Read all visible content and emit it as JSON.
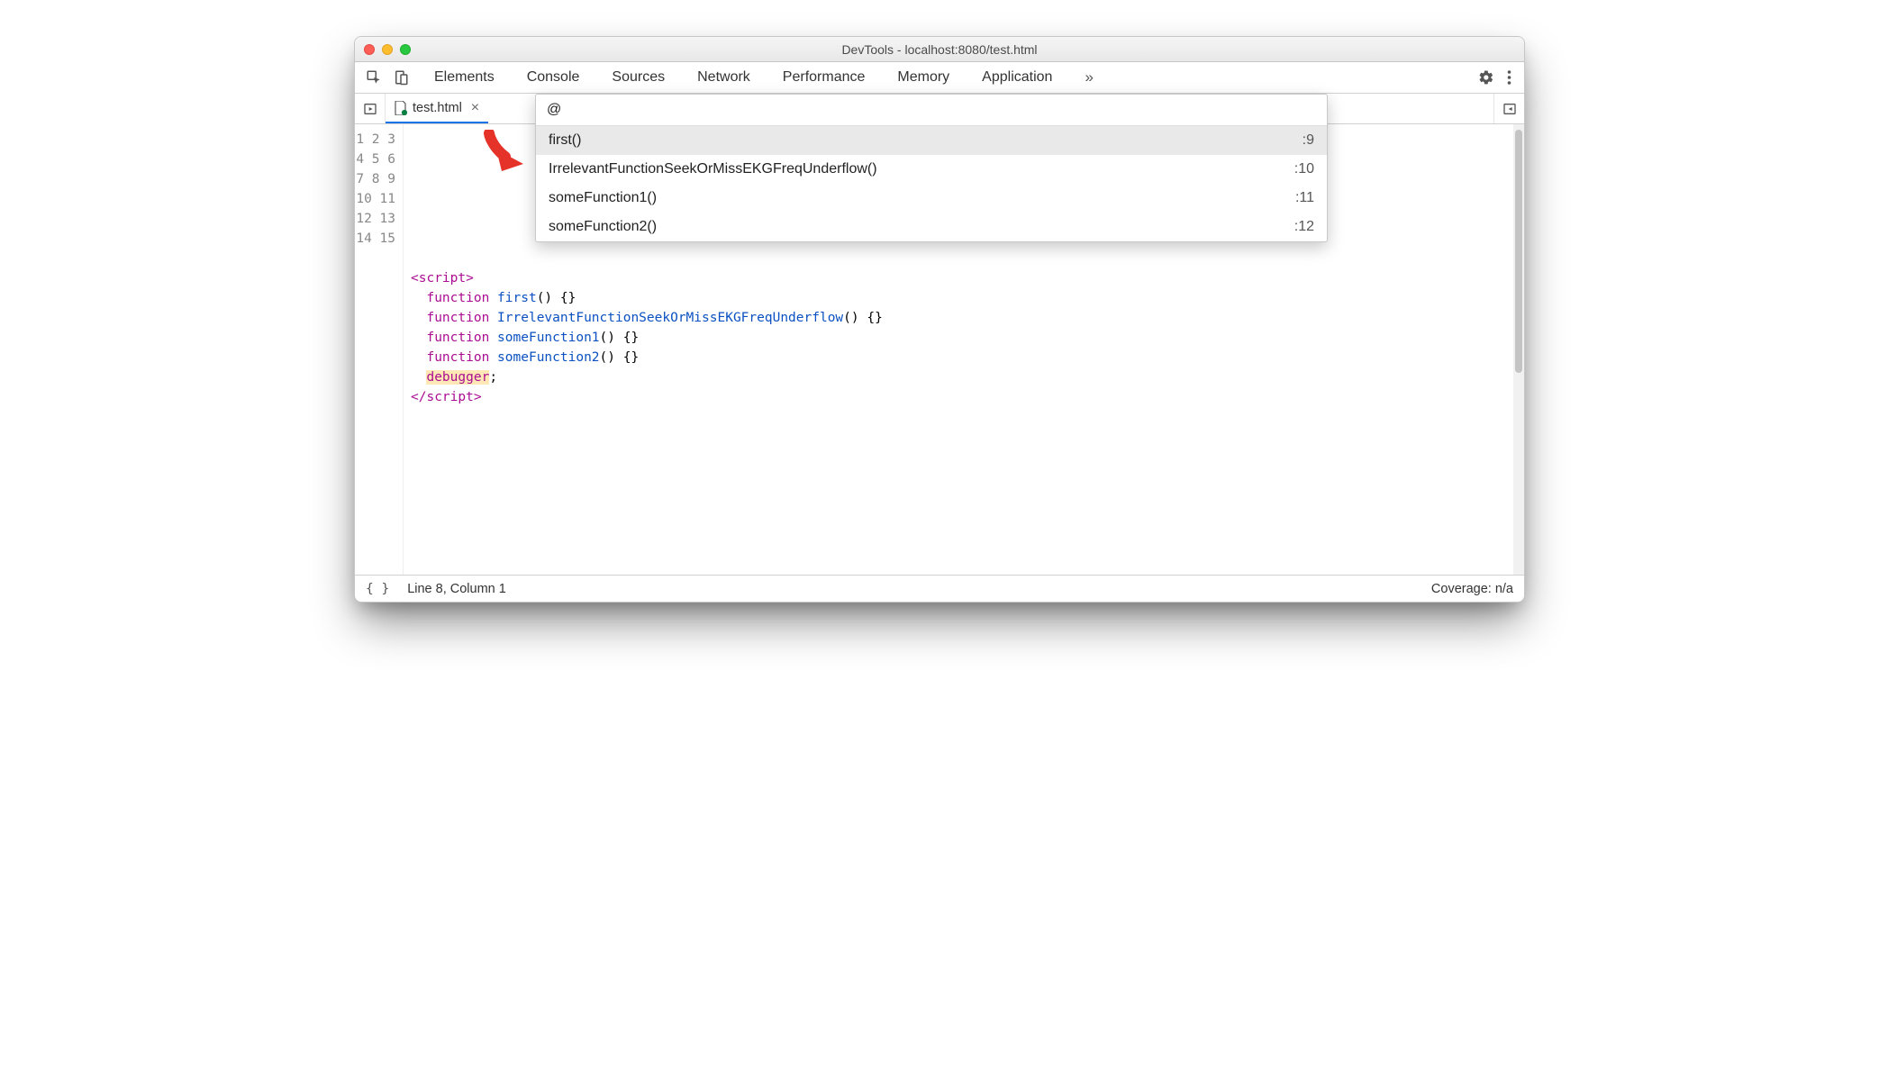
{
  "window": {
    "title": "DevTools - localhost:8080/test.html"
  },
  "toolbar": {
    "tabs": [
      "Elements",
      "Console",
      "Sources",
      "Network",
      "Performance",
      "Memory",
      "Application"
    ],
    "active_tab_index": 2
  },
  "file_tab": {
    "name": "test.html"
  },
  "quickopen": {
    "query": "@",
    "items": [
      {
        "label": "first()",
        "line": ":9"
      },
      {
        "label": "IrrelevantFunctionSeekOrMissEKGFreqUnderflow()",
        "line": ":10"
      },
      {
        "label": "someFunction1()",
        "line": ":11"
      },
      {
        "label": "someFunction2()",
        "line": ":12"
      }
    ],
    "selected_index": 0
  },
  "source": {
    "line_count": 15,
    "functions": [
      {
        "name": "first"
      },
      {
        "name": "IrrelevantFunctionSeekOrMissEKGFreqUnderflow"
      },
      {
        "name": "someFunction1"
      },
      {
        "name": "someFunction2"
      }
    ]
  },
  "statusbar": {
    "position": "Line 8, Column 1",
    "coverage": "Coverage: n/a"
  }
}
